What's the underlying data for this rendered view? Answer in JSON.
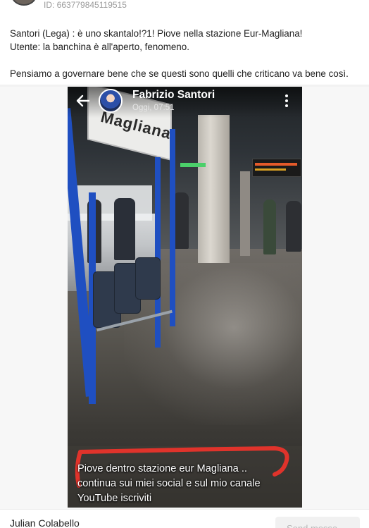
{
  "post": {
    "id_text": "ID: 663779845119515",
    "lines": [
      "Santori (Lega) : è uno skantalo!?1! Piove nella stazione Eur-Magliana!",
      "Utente: la banchina è all'aperto, fenomeno.",
      "Pensiamo a governare bene che se questi sono quelli che criticano va bene così."
    ]
  },
  "video": {
    "channel_name": "Fabrizio Santori",
    "timestamp": "Oggi, 07:51",
    "sign_text": "Magliana",
    "caption_lines": [
      "Piove dentro stazione eur Magliana ..",
      "continua sui miei social e sul mio canale",
      "YouTube iscriviti"
    ],
    "icons": {
      "back": "back-arrow-icon",
      "more": "more-vertical-icon"
    },
    "colors": {
      "annotation": "#e0332b"
    }
  },
  "footer": {
    "commenter_name": "Julian Colabello",
    "send_label": "Send messa"
  }
}
